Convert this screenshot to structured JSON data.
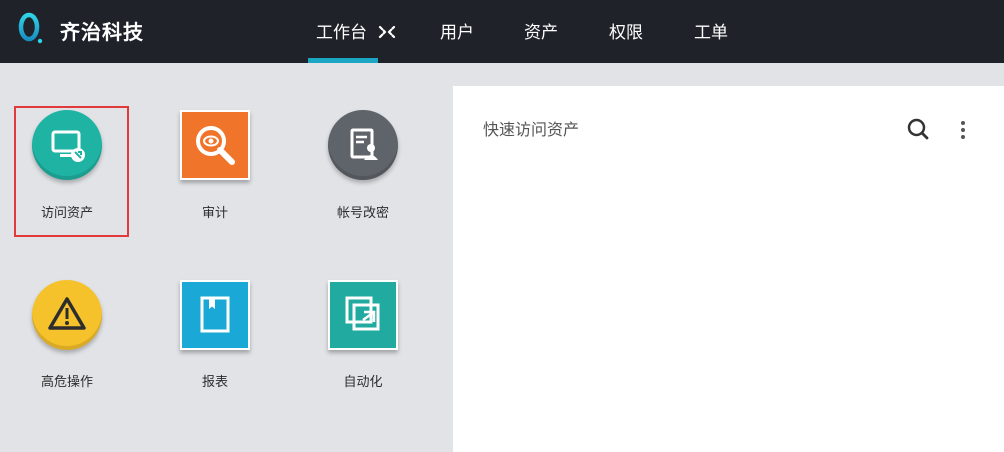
{
  "header": {
    "brand": "齐治科技",
    "nav": [
      {
        "label": "工作台",
        "active": true
      },
      {
        "label": "用户"
      },
      {
        "label": "资产"
      },
      {
        "label": "权限"
      },
      {
        "label": "工单"
      }
    ],
    "active_color": "#1ba7c4"
  },
  "apps": [
    {
      "label": "访问资产",
      "icon": "monitor-icon",
      "color": "#1fb3a4",
      "selected": true
    },
    {
      "label": "审计",
      "icon": "magnifier-eye-icon",
      "color": "#f0752a"
    },
    {
      "label": "帐号改密",
      "icon": "account-document-icon",
      "color": "#5f636a"
    },
    {
      "label": "高危操作",
      "icon": "warning-icon",
      "color": "#f6c22b"
    },
    {
      "label": "报表",
      "icon": "report-book-icon",
      "color": "#1aa8d6"
    },
    {
      "label": "自动化",
      "icon": "automation-icon",
      "color": "#20aaa0"
    }
  ],
  "panel": {
    "title": "快速访问资产"
  }
}
